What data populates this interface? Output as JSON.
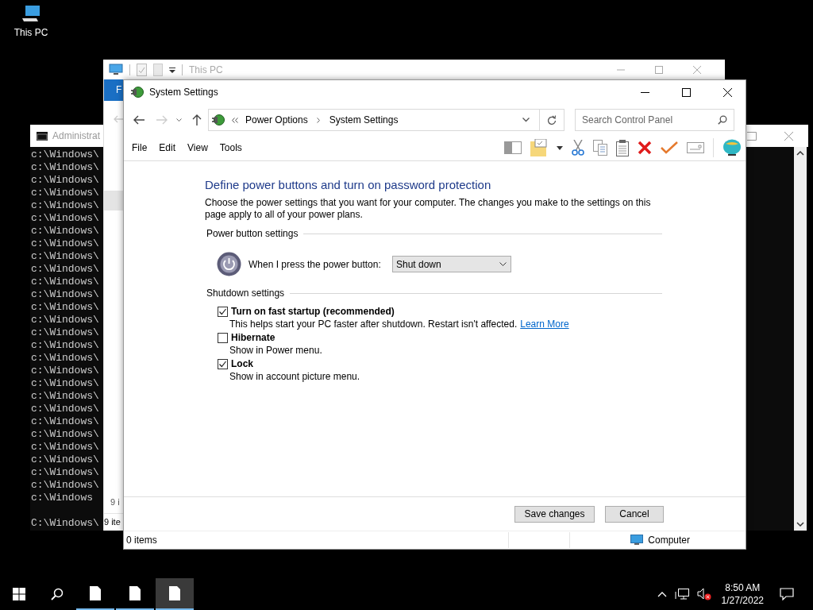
{
  "desktop": {
    "icons": [
      {
        "label": "This PC"
      }
    ]
  },
  "console_window": {
    "title": "Administrat",
    "lines": [
      "c:\\Windows\\",
      "c:\\Windows\\",
      "c:\\Windows\\",
      "c:\\Windows\\",
      "c:\\Windows\\",
      "c:\\Windows\\",
      "c:\\Windows\\",
      "c:\\Windows\\",
      "c:\\Windows\\",
      "c:\\Windows\\",
      "c:\\Windows\\",
      "c:\\Windows\\",
      "c:\\Windows\\",
      "c:\\Windows\\",
      "c:\\Windows\\",
      "c:\\Windows\\",
      "c:\\Windows\\",
      "c:\\Windows\\",
      "c:\\Windows\\",
      "c:\\Windows\\",
      "c:\\Windows\\",
      "c:\\Windows\\",
      "c:\\Windows\\",
      "c:\\Windows\\",
      "c:\\Windows\\",
      "c:\\Windows\\",
      "c:\\Windows\\",
      "c:\\Windows"
    ],
    "prompt": "C:\\Windows\\"
  },
  "explorer_window": {
    "title": "This PC",
    "ribbon_tab": "F",
    "item_count": "9 i",
    "status": "9 ite"
  },
  "dialog": {
    "title": "System Settings",
    "breadcrumb": [
      "Power Options",
      "System Settings"
    ],
    "search": {
      "placeholder": "Search Control Panel"
    },
    "menu": [
      "File",
      "Edit",
      "View",
      "Tools"
    ],
    "heading": "Define power buttons and turn on password protection",
    "description": "Choose the power settings that you want for your computer. The changes you make to the settings on this page apply to all of your power plans.",
    "power_button": {
      "section": "Power button settings",
      "label": "When I press the power button:",
      "value": "Shut down"
    },
    "shutdown": {
      "section": "Shutdown settings",
      "options": [
        {
          "label": "Turn on fast startup (recommended)",
          "description": "This helps start your PC faster after shutdown. Restart isn't affected.",
          "link": "Learn More",
          "checked": true
        },
        {
          "label": "Hibernate",
          "description": "Show in Power menu.",
          "checked": false
        },
        {
          "label": "Lock",
          "description": "Show in account picture menu.",
          "checked": true
        }
      ]
    },
    "buttons": [
      "Save changes",
      "Cancel"
    ],
    "status_bar": {
      "items": "0 items",
      "location": "Computer"
    }
  },
  "taskbar": {
    "apps": [
      {
        "selected": false
      },
      {
        "selected": false
      },
      {
        "selected": true
      }
    ],
    "time": "8:50 AM",
    "date": "1/27/2022"
  }
}
